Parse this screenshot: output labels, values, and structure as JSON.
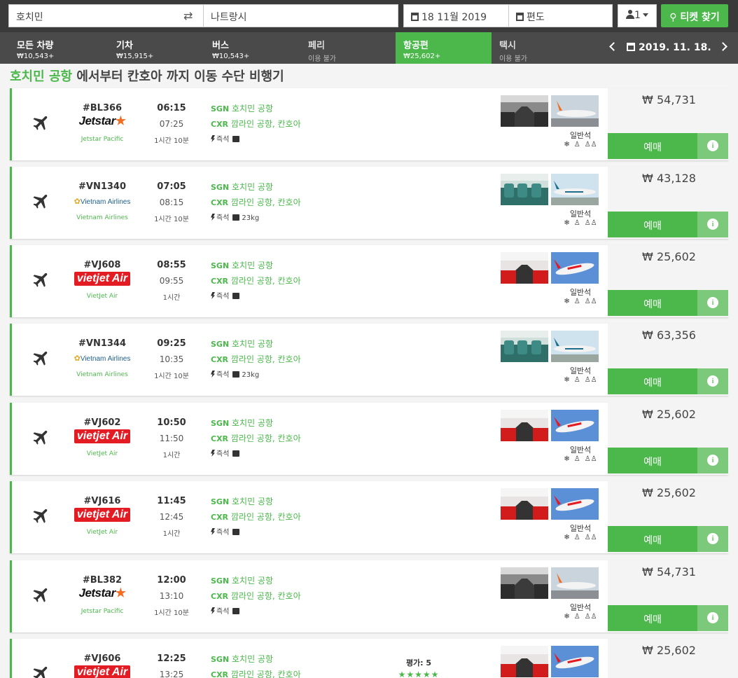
{
  "search": {
    "from": "호치민",
    "swap_icon": "swap-icon",
    "to": "나트랑시",
    "date": "18 11월 2019",
    "return": "편도",
    "passengers": "1",
    "search_button": "티켓 찾기"
  },
  "tabs": [
    {
      "name": "모든 차량",
      "sub": "₩10,543+",
      "state": "normal"
    },
    {
      "name": "기차",
      "sub": "₩15,915+",
      "state": "normal"
    },
    {
      "name": "버스",
      "sub": "₩10,543+",
      "state": "normal"
    },
    {
      "name": "페리",
      "sub": "이용 불가",
      "state": "disabled"
    },
    {
      "name": "항공편",
      "sub": "₩25,602+",
      "state": "active"
    },
    {
      "name": "택시",
      "sub": "이용 불가",
      "state": "disabled"
    }
  ],
  "date_nav": {
    "date": "2019. 11. 18."
  },
  "heading": {
    "from_place": "호치민 공항",
    "text": " 에서부터 칸호아 까지 이동 수단 비행기"
  },
  "colors": {
    "accent": "#4cb84c",
    "header_bg": "#3a3a3a",
    "tabs_bg": "#4a4a4a",
    "info_bg": "#7cc97c"
  },
  "flights": [
    {
      "flight_no": "#BL366",
      "airline_logo": "jetstar",
      "airline": "Jetstar Pacific",
      "dep": "06:15",
      "arr": "07:25",
      "duration": "1시간 10분",
      "from_code": "SGN",
      "from_name": "호치민 공항",
      "to_code": "CXR",
      "to_name": "깜라인 공항, 칸호아",
      "instant": "즉석",
      "baggage": "",
      "class": "일반석",
      "price": "₩ 54,731",
      "book": "예매"
    },
    {
      "flight_no": "#VN1340",
      "airline_logo": "vietnam",
      "airline": "Vietnam Airlines",
      "dep": "07:05",
      "arr": "08:15",
      "duration": "1시간 10분",
      "from_code": "SGN",
      "from_name": "호치민 공항",
      "to_code": "CXR",
      "to_name": "깜라인 공항, 칸호아",
      "instant": "즉석",
      "baggage": "23kg",
      "class": "일반석",
      "price": "₩ 43,128",
      "book": "예매"
    },
    {
      "flight_no": "#VJ608",
      "airline_logo": "vietjet",
      "airline": "VietJet Air",
      "dep": "08:55",
      "arr": "09:55",
      "duration": "1시간",
      "from_code": "SGN",
      "from_name": "호치민 공항",
      "to_code": "CXR",
      "to_name": "깜라인 공항, 칸호아",
      "instant": "즉석",
      "baggage": "",
      "class": "일반석",
      "price": "₩ 25,602",
      "book": "예매"
    },
    {
      "flight_no": "#VN1344",
      "airline_logo": "vietnam",
      "airline": "Vietnam Airlines",
      "dep": "09:25",
      "arr": "10:35",
      "duration": "1시간 10분",
      "from_code": "SGN",
      "from_name": "호치민 공항",
      "to_code": "CXR",
      "to_name": "깜라인 공항, 칸호아",
      "instant": "즉석",
      "baggage": "23kg",
      "class": "일반석",
      "price": "₩ 63,356",
      "book": "예매"
    },
    {
      "flight_no": "#VJ602",
      "airline_logo": "vietjet",
      "airline": "VietJet Air",
      "dep": "10:50",
      "arr": "11:50",
      "duration": "1시간",
      "from_code": "SGN",
      "from_name": "호치민 공항",
      "to_code": "CXR",
      "to_name": "깜라인 공항, 칸호아",
      "instant": "즉석",
      "baggage": "",
      "class": "일반석",
      "price": "₩ 25,602",
      "book": "예매"
    },
    {
      "flight_no": "#VJ616",
      "airline_logo": "vietjet",
      "airline": "VietJet Air",
      "dep": "11:45",
      "arr": "12:45",
      "duration": "1시간",
      "from_code": "SGN",
      "from_name": "호치민 공항",
      "to_code": "CXR",
      "to_name": "깜라인 공항, 칸호아",
      "instant": "즉석",
      "baggage": "",
      "class": "일반석",
      "price": "₩ 25,602",
      "book": "예매"
    },
    {
      "flight_no": "#BL382",
      "airline_logo": "jetstar",
      "airline": "Jetstar Pacific",
      "dep": "12:00",
      "arr": "13:10",
      "duration": "1시간 10분",
      "from_code": "SGN",
      "from_name": "호치민 공항",
      "to_code": "CXR",
      "to_name": "깜라인 공항, 칸호아",
      "instant": "즉석",
      "baggage": "",
      "class": "일반석",
      "price": "₩ 54,731",
      "book": "예매"
    },
    {
      "flight_no": "#VJ606",
      "airline_logo": "vietjet",
      "airline": "",
      "dep": "12:25",
      "arr": "13:25",
      "duration": "",
      "from_code": "SGN",
      "from_name": "호치민 공항",
      "to_code": "CXR",
      "to_name": "깜라인 공항, 칸호아",
      "instant": "",
      "baggage": "",
      "class": "",
      "price": "₩ 25,602",
      "book": "",
      "rating_label": "평가: 5",
      "rating_value": 5
    }
  ]
}
